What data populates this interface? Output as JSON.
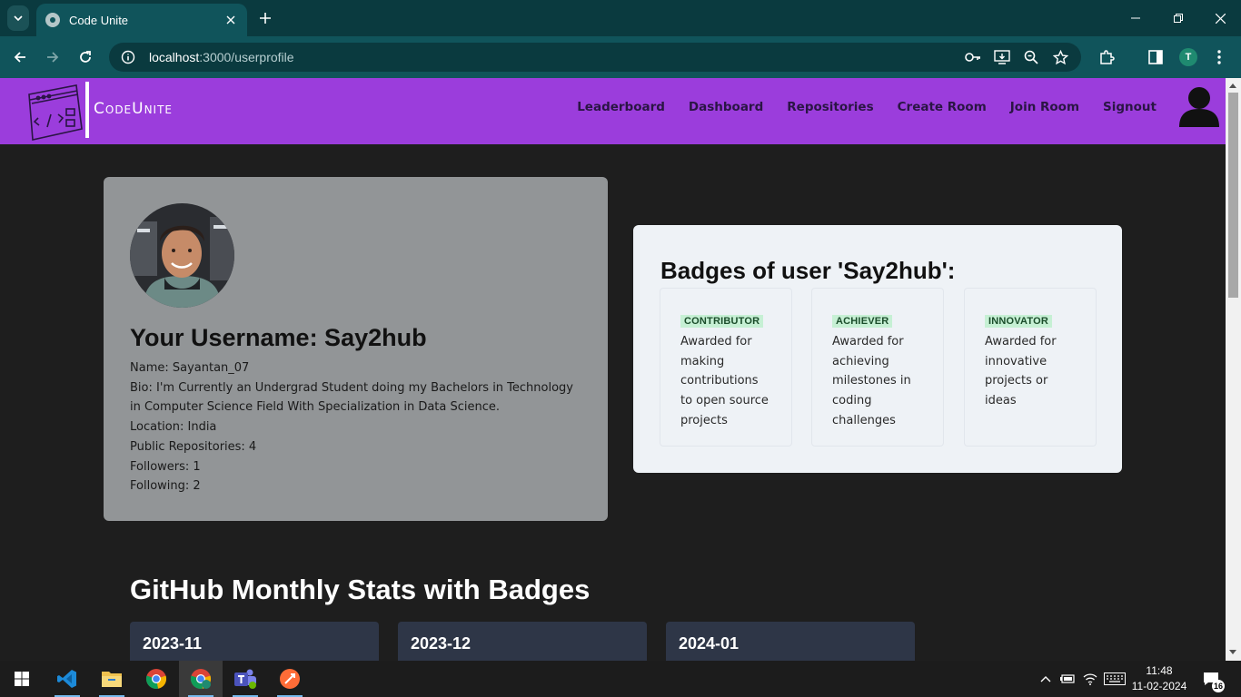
{
  "browser": {
    "tab_title": "Code Unite",
    "url_host": "localhost",
    "url_path": ":3000/userprofile",
    "profile_initial": "T"
  },
  "navbar": {
    "logo_text": "CodeUnite",
    "links": [
      "Leaderboard",
      "Dashboard",
      "Repositories",
      "Create Room",
      "Join Room",
      "Signout"
    ]
  },
  "profile": {
    "username_heading": "Your Username: Say2hub",
    "name": "Name: Sayantan_07",
    "bio": "Bio: I'm Currently an Undergrad Student doing my Bachelors in Technology in Computer Science Field With Specialization in Data Science.",
    "location": "Location: India",
    "public_repos": "Public Repositories: 4",
    "followers": "Followers: 1",
    "following": "Following: 2"
  },
  "badges": {
    "title": "Badges of user 'Say2hub':",
    "items": [
      {
        "tag": "CONTRIBUTOR",
        "description": "Awarded for making contributions to open source projects"
      },
      {
        "tag": "ACHIEVER",
        "description": "Awarded for achieving milestones in coding challenges"
      },
      {
        "tag": "INNOVATOR",
        "description": "Awarded for innovative projects or ideas"
      }
    ]
  },
  "monthly_stats": {
    "title": "GitHub Monthly Stats with Badges",
    "months": [
      "2023-11",
      "2023-12",
      "2024-01"
    ]
  },
  "taskbar": {
    "time": "11:48",
    "date": "11-02-2024",
    "notification_count": "16",
    "apps": [
      "vscode-icon",
      "file-explorer-icon",
      "chrome-icon",
      "chrome-profile-icon",
      "teams-icon",
      "postman-icon"
    ]
  },
  "colors": {
    "navbar": "#9b3ddc",
    "page_bg": "#1e1e1e",
    "profile_card": "#929597",
    "badges_card": "#eef2f6",
    "badge_tag_bg": "#c6f0d4",
    "month_card": "#2e3647",
    "chrome_tab": "#10545b"
  }
}
